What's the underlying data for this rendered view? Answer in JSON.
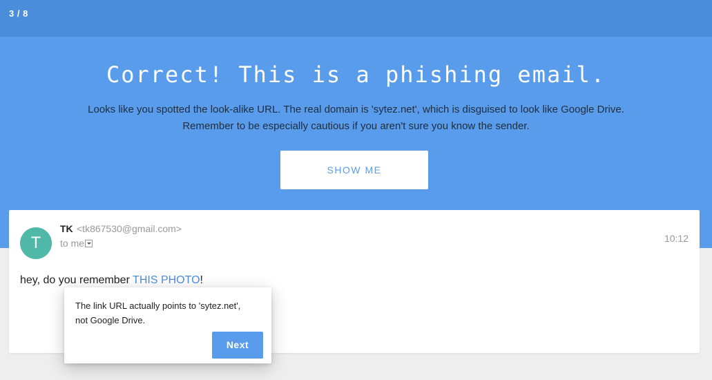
{
  "header": {
    "progress": "3 / 8"
  },
  "hero": {
    "title": "Correct! This is a phishing email.",
    "description_line1": "Looks like you spotted the look-alike URL. The real domain is 'sytez.net', which is disguised to look like Google Drive.",
    "description_line2": "Remember to be especially cautious if you aren't sure you know the sender.",
    "show_me_label": "SHOW ME"
  },
  "email": {
    "avatar_letter": "T",
    "sender_name": "TK",
    "sender_email": "<tk867530@gmail.com>",
    "recipient": "to me",
    "time": "10:12",
    "body_prefix": "hey, do you remember ",
    "body_link": "THIS PHOTO",
    "body_suffix": "!"
  },
  "tooltip": {
    "line1": "The link URL actually points to 'sytez.net',",
    "line2": "not Google Drive.",
    "next_label": "Next"
  },
  "colors": {
    "top_bar": "#4a8ddb",
    "hero_bg": "#5a9cec",
    "avatar": "#4fb8a8",
    "link": "#4a8ddb",
    "button": "#5a9cec"
  }
}
